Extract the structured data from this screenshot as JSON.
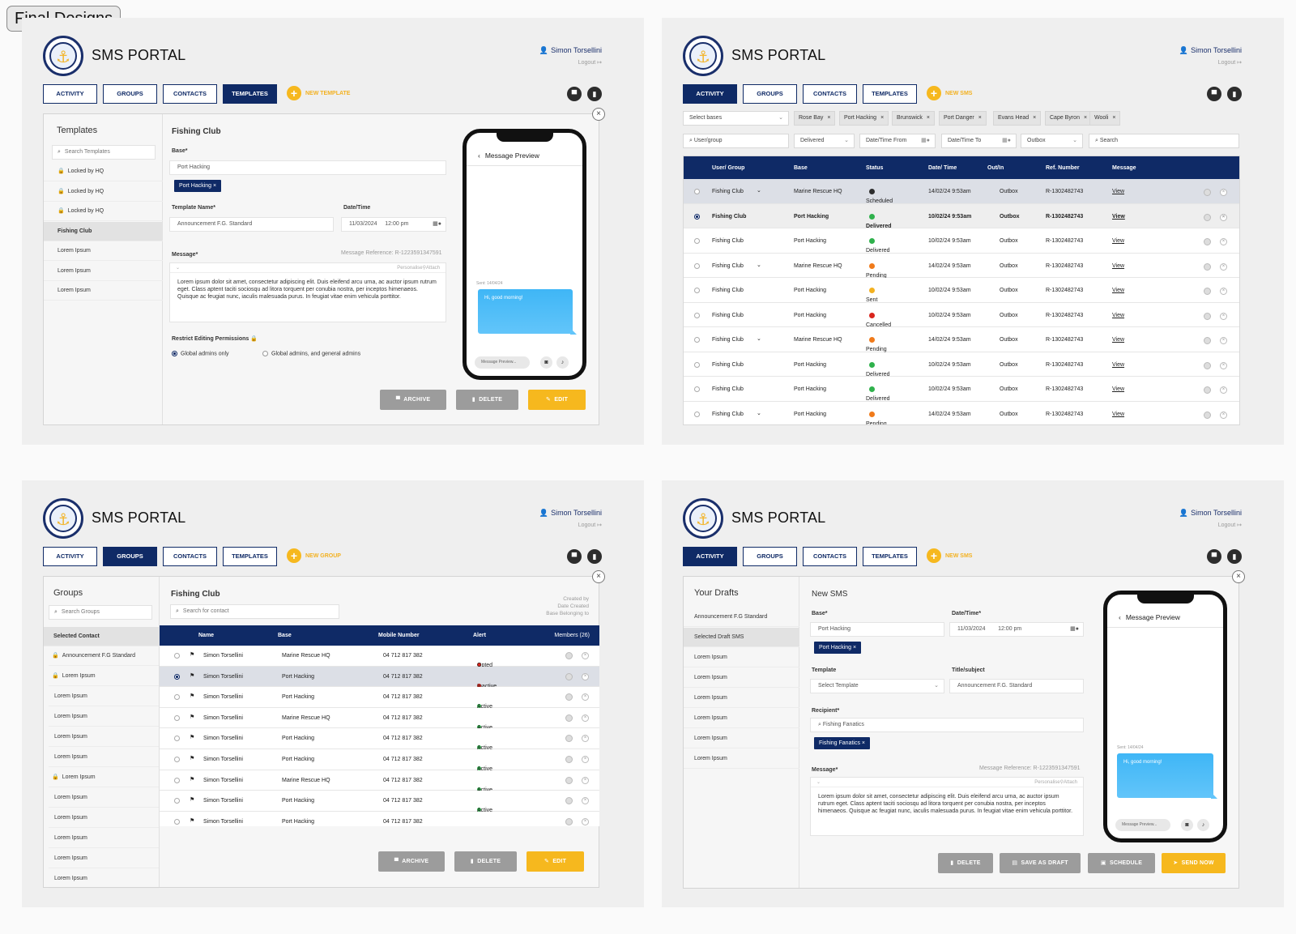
{
  "frame_label": "Final Designs",
  "app": {
    "title": "SMS PORTAL",
    "user": "Simon Torsellini",
    "logout": "Logout"
  },
  "nav": {
    "activity": "ACTIVITY",
    "groups": "GROUPS",
    "contacts": "CONTACTS",
    "templates": "TEMPLATES",
    "new_template": "NEW TEMPLATE",
    "new_sms": "NEW SMS",
    "new_group": "NEW GROUP"
  },
  "colors": {
    "navy": "#0f2a66",
    "yellow": "#f6b81e",
    "gray_btn": "#9c9c9c",
    "bubble": "#4bbcf8"
  },
  "icons": [
    "user-icon",
    "logout-icon",
    "archive-icon",
    "trash-icon",
    "close-icon",
    "search-icon",
    "lock-icon",
    "calendar-icon",
    "clock-icon",
    "paperclip-icon",
    "camera-icon",
    "mic-icon",
    "flag-icon",
    "edit-icon",
    "send-icon"
  ],
  "templates": {
    "heading": "Templates",
    "search_placeholder": "Search Templates",
    "items": [
      "Locked by HQ",
      "Locked by HQ",
      "Locked by HQ",
      "Fishing Club",
      "Lorem Ipsum",
      "Lorem Ipsum",
      "Lorem Ipsum"
    ],
    "form_title": "Fishing Club",
    "base_label": "Base*",
    "base_value": "Port Hacking",
    "base_chip": "Port Hacking",
    "template_name_label": "Template Name*",
    "template_name_value": "Announcement F.G. Standard",
    "datetime_label": "Date/Time",
    "date_value": "11/03/2024",
    "time_value": "12:00 pm",
    "message_label": "Message*",
    "message_reference": "Message Reference: R-1223591347591",
    "personalise": "Personalise",
    "attach": "Attach",
    "message_body": "Lorem ipsum dolor sit amet, consectetur adipiscing elit. Duis eleifend arcu urna, ac auctor ipsum rutrum eget. Class aptent taciti sociosqu ad litora torquent per conubia nostra, per inceptos himenaeos. Quisque ac feugiat nunc, iaculis malesuada purus. In feugiat vitae enim vehicula porttitor.",
    "restrict_label": "Restrict Editing Permissions",
    "radio1": "Global admins only",
    "radio2": "Global admins, and general admins",
    "archive": "ARCHIVE",
    "delete": "DELETE",
    "edit": "EDIT"
  },
  "preview": {
    "title": "Message Preview",
    "sent": "Sent: 14/04/24",
    "bubble": "Hi, good morning!",
    "input_placeholder": "Message Preview..."
  },
  "activity": {
    "select_bases": "Select bases",
    "tags": [
      "Rose Bay",
      "Port Hacking",
      "Brunswick",
      "Port Danger",
      "Evans Head",
      "Cape Byron",
      "Wooli"
    ],
    "user_group_placeholder": "User/group",
    "status_filter": "Delivered",
    "date_from": "Date/Time From",
    "date_to": "Date/Time To",
    "direction_filter": "Outbox",
    "search_placeholder": "Search",
    "columns": [
      "User/ Group",
      "Base",
      "Status",
      "Date/ Time",
      "Out/In",
      "Ref. Number",
      "Message"
    ],
    "rows": [
      {
        "group": "Fishing Club",
        "base": "Marine Rescue HQ",
        "status": "Scheduled",
        "date": "14/02/24  9:53am",
        "dir": "Outbox",
        "ref": "R-1302482743",
        "msg": "View",
        "expand": true,
        "color": "#2d2d2d"
      },
      {
        "group": "Fishing Club",
        "base": "Port Hacking",
        "status": "Delivered",
        "date": "10/02/24  9:53am",
        "dir": "Outbox",
        "ref": "R-1302482743",
        "msg": "View",
        "expand": false,
        "color": "#2fb14c"
      },
      {
        "group": "Fishing Club",
        "base": "Port Hacking",
        "status": "Delivered",
        "date": "10/02/24  9:53am",
        "dir": "Outbox",
        "ref": "R-1302482743",
        "msg": "View",
        "expand": false,
        "color": "#2fb14c"
      },
      {
        "group": "Fishing Club",
        "base": "Marine Rescue HQ",
        "status": "Pending",
        "date": "14/02/24  9:53am",
        "dir": "Outbox",
        "ref": "R-1302482743",
        "msg": "View",
        "expand": true,
        "color": "#f07a1a"
      },
      {
        "group": "Fishing Club",
        "base": "Port Hacking",
        "status": "Sent",
        "date": "10/02/24  9:53am",
        "dir": "Outbox",
        "ref": "R-1302482743",
        "msg": "View",
        "expand": false,
        "color": "#f3b120"
      },
      {
        "group": "Fishing Club",
        "base": "Port Hacking",
        "status": "Cancelled",
        "date": "10/02/24  9:53am",
        "dir": "Outbox",
        "ref": "R-1302482743",
        "msg": "View",
        "expand": false,
        "color": "#d9251d"
      },
      {
        "group": "Fishing Club",
        "base": "Marine Rescue HQ",
        "status": "Pending",
        "date": "14/02/24  9:53am",
        "dir": "Outbox",
        "ref": "R-1302482743",
        "msg": "View",
        "expand": true,
        "color": "#f07a1a"
      },
      {
        "group": "Fishing Club",
        "base": "Port Hacking",
        "status": "Delivered",
        "date": "10/02/24  9:53am",
        "dir": "Outbox",
        "ref": "R-1302482743",
        "msg": "View",
        "expand": false,
        "color": "#2fb14c"
      },
      {
        "group": "Fishing Club",
        "base": "Port Hacking",
        "status": "Delivered",
        "date": "10/02/24  9:53am",
        "dir": "Outbox",
        "ref": "R-1302482743",
        "msg": "View",
        "expand": false,
        "color": "#2fb14c"
      },
      {
        "group": "Fishing Club",
        "base": "Port Hacking",
        "status": "Pending",
        "date": "14/02/24  9:53am",
        "dir": "Outbox",
        "ref": "R-1302482743",
        "msg": "View",
        "expand": true,
        "color": "#f07a1a"
      }
    ]
  },
  "groups": {
    "heading": "Groups",
    "search_placeholder": "Search Groups",
    "selected_contact": "Selected Contact",
    "items": [
      {
        "label": "Announcement F.G Standard",
        "locked": true
      },
      {
        "label": "Lorem Ipsum",
        "locked": true
      },
      {
        "label": "Lorem Ipsum",
        "locked": false
      },
      {
        "label": "Lorem Ipsum",
        "locked": false
      },
      {
        "label": "Lorem Ipsum",
        "locked": false
      },
      {
        "label": "Lorem Ipsum",
        "locked": false
      },
      {
        "label": "Lorem Ipsum",
        "locked": true
      },
      {
        "label": "Lorem Ipsum",
        "locked": false
      },
      {
        "label": "Lorem Ipsum",
        "locked": false
      },
      {
        "label": "Lorem Ipsum",
        "locked": false
      },
      {
        "label": "Lorem Ipsum",
        "locked": false
      },
      {
        "label": "Lorem Ipsum",
        "locked": false
      }
    ],
    "group_title": "Fishing Club",
    "contact_search": "Search for contact",
    "created_by": "Created by",
    "date_created": "Date Created",
    "base_belonging": "Base Belonging to",
    "columns": [
      "Name",
      "Base",
      "Mobile Number",
      "Alert",
      "Members (26)"
    ],
    "rows": [
      {
        "name": "Simon Torsellini",
        "base": "Marine Rescue HQ",
        "mobile": "04 712 817 382",
        "alert": "Opted out",
        "color": "#d9251d"
      },
      {
        "name": "Simon Torsellini",
        "base": "Port Hacking",
        "mobile": "04 712 817 382",
        "alert": "Inactive",
        "color": "#d9251d"
      },
      {
        "name": "Simon Torsellini",
        "base": "Port Hacking",
        "mobile": "04 712 817 382",
        "alert": "Active",
        "color": "#2fb14c"
      },
      {
        "name": "Simon Torsellini",
        "base": "Marine Rescue HQ",
        "mobile": "04 712 817 382",
        "alert": "Active",
        "color": "#2fb14c"
      },
      {
        "name": "Simon Torsellini",
        "base": "Port Hacking",
        "mobile": "04 712 817 382",
        "alert": "Active",
        "color": "#2fb14c"
      },
      {
        "name": "Simon Torsellini",
        "base": "Port Hacking",
        "mobile": "04 712 817 382",
        "alert": "Active",
        "color": "#2fb14c"
      },
      {
        "name": "Simon Torsellini",
        "base": "Marine Rescue HQ",
        "mobile": "04 712 817 382",
        "alert": "Active",
        "color": "#2fb14c"
      },
      {
        "name": "Simon Torsellini",
        "base": "Port Hacking",
        "mobile": "04 712 817 382",
        "alert": "Active",
        "color": "#2fb14c"
      },
      {
        "name": "Simon Torsellini",
        "base": "Port Hacking",
        "mobile": "04 712 817 382",
        "alert": "Active",
        "color": "#2fb14c"
      }
    ],
    "archive": "ARCHIVE",
    "delete": "DELETE",
    "edit": "EDIT"
  },
  "drafts": {
    "heading": "Your Drafts",
    "items": [
      "Announcement F.G Standard",
      "Selected Draft SMS",
      "Lorem Ipsum",
      "Lorem Ipsum",
      "Lorem Ipsum",
      "Lorem Ipsum",
      "Lorem Ipsum",
      "Lorem Ipsum"
    ],
    "form_title": "New SMS",
    "base_label": "Base*",
    "base_value": "Port Hacking",
    "base_chip": "Port Hacking",
    "datetime_label": "Date/Time*",
    "date_value": "11/03/2024",
    "time_value": "12:00 pm",
    "template_label": "Template",
    "template_value": "Select Template",
    "title_label": "Title/subject",
    "title_value": "Announcement F.G. Standard",
    "recipient_label": "Recipient*",
    "recipient_value": "Fishing Fanatics",
    "recipient_chip": "Fishing Fanatics",
    "message_label": "Message*",
    "message_reference": "Message Reference: R-1223591347591",
    "personalise": "Personalise",
    "attach": "Attach",
    "message_body": "Lorem ipsum dolor sit amet, consectetur adipiscing elit. Duis eleifend arcu urna, ac auctor ipsum rutrum eget. Class aptent taciti sociosqu ad litora torquent per conubia nostra, per inceptos himenaeos. Quisque ac feugiat nunc, iaculis malesuada purus. In feugiat vitae enim vehicula porttitor.",
    "delete": "DELETE",
    "save_draft": "SAVE AS DRAFT",
    "schedule": "SCHEDULE",
    "send_now": "SEND NOW"
  }
}
